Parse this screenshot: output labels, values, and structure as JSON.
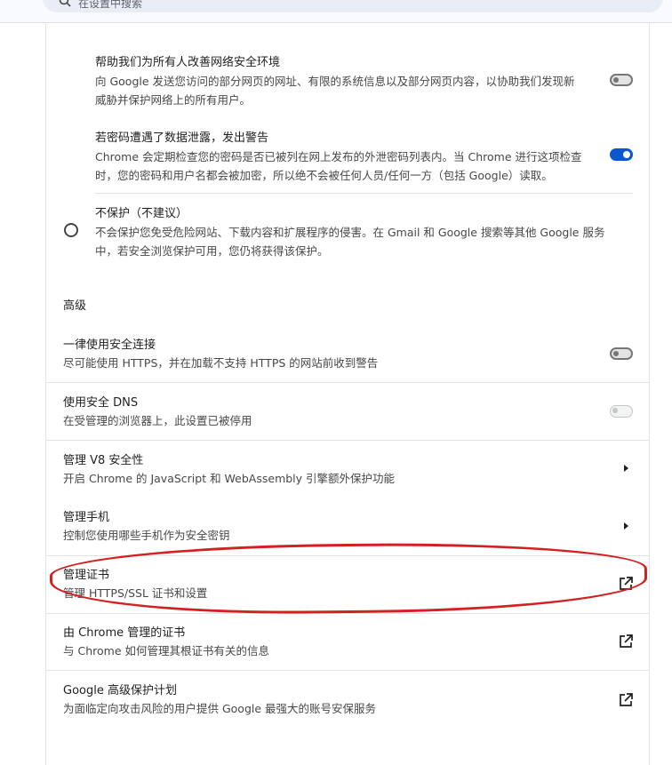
{
  "search": {
    "placeholder": "在设置中搜索"
  },
  "protection": {
    "help_improve": {
      "title": "帮助我们为所有人改善网络安全环境",
      "desc_line1": "向 Google 发送您访问的部分网页的网址、有限的系统信息以及部分网页内容，以协助我们发现新",
      "desc_line2": "威胁并保护网络上的所有用户。",
      "enabled": false
    },
    "password_leak": {
      "title": "若密码遭遇了数据泄露，发出警告",
      "desc_line1": "Chrome 会定期检查您的密码是否已被列在网上发布的外泄密码列表内。当 Chrome 进行这项检查",
      "desc_line2": "时，您的密码和用户名都会被加密，所以绝不会被任何人员/任何一方（包括 Google）读取。",
      "enabled": true
    },
    "no_protection": {
      "title": "不保护（不建议）",
      "desc_line1": "不会保护您免受危险网站、下载内容和扩展程序的侵害。在 Gmail 和 Google 搜索等其他 Google 服务",
      "desc_line2": "中，若安全浏览保护可用，您仍将获得该保护。",
      "selected": false
    }
  },
  "advanced": {
    "heading": "高级",
    "items": [
      {
        "title": "一律使用安全连接",
        "desc": "尽可能使用 HTTPS，并在加载不支持 HTTPS 的网站前收到警告",
        "control": "toggle-off"
      },
      {
        "title": "使用安全 DNS",
        "desc": "在受管理的浏览器上，此设置已被停用",
        "control": "toggle-disabled"
      },
      {
        "title": "管理 V8 安全性",
        "desc": "开启 Chrome 的 JavaScript 和 WebAssembly 引擎额外保护功能",
        "control": "arrow"
      },
      {
        "title": "管理手机",
        "desc": "控制您使用哪些手机作为安全密钥",
        "control": "arrow"
      },
      {
        "title": "管理证书",
        "desc": "管理 HTTPS/SSL 证书和设置",
        "control": "external"
      },
      {
        "title": "由 Chrome 管理的证书",
        "desc": "与 Chrome 如何管理其根证书有关的信息",
        "control": "external"
      },
      {
        "title": "Google 高级保护计划",
        "desc": "为面临定向攻击风险的用户提供 Google 最强大的账号安保服务",
        "control": "external"
      }
    ]
  },
  "colors": {
    "accent": "#0b57d0",
    "annotation": "#d32020"
  }
}
